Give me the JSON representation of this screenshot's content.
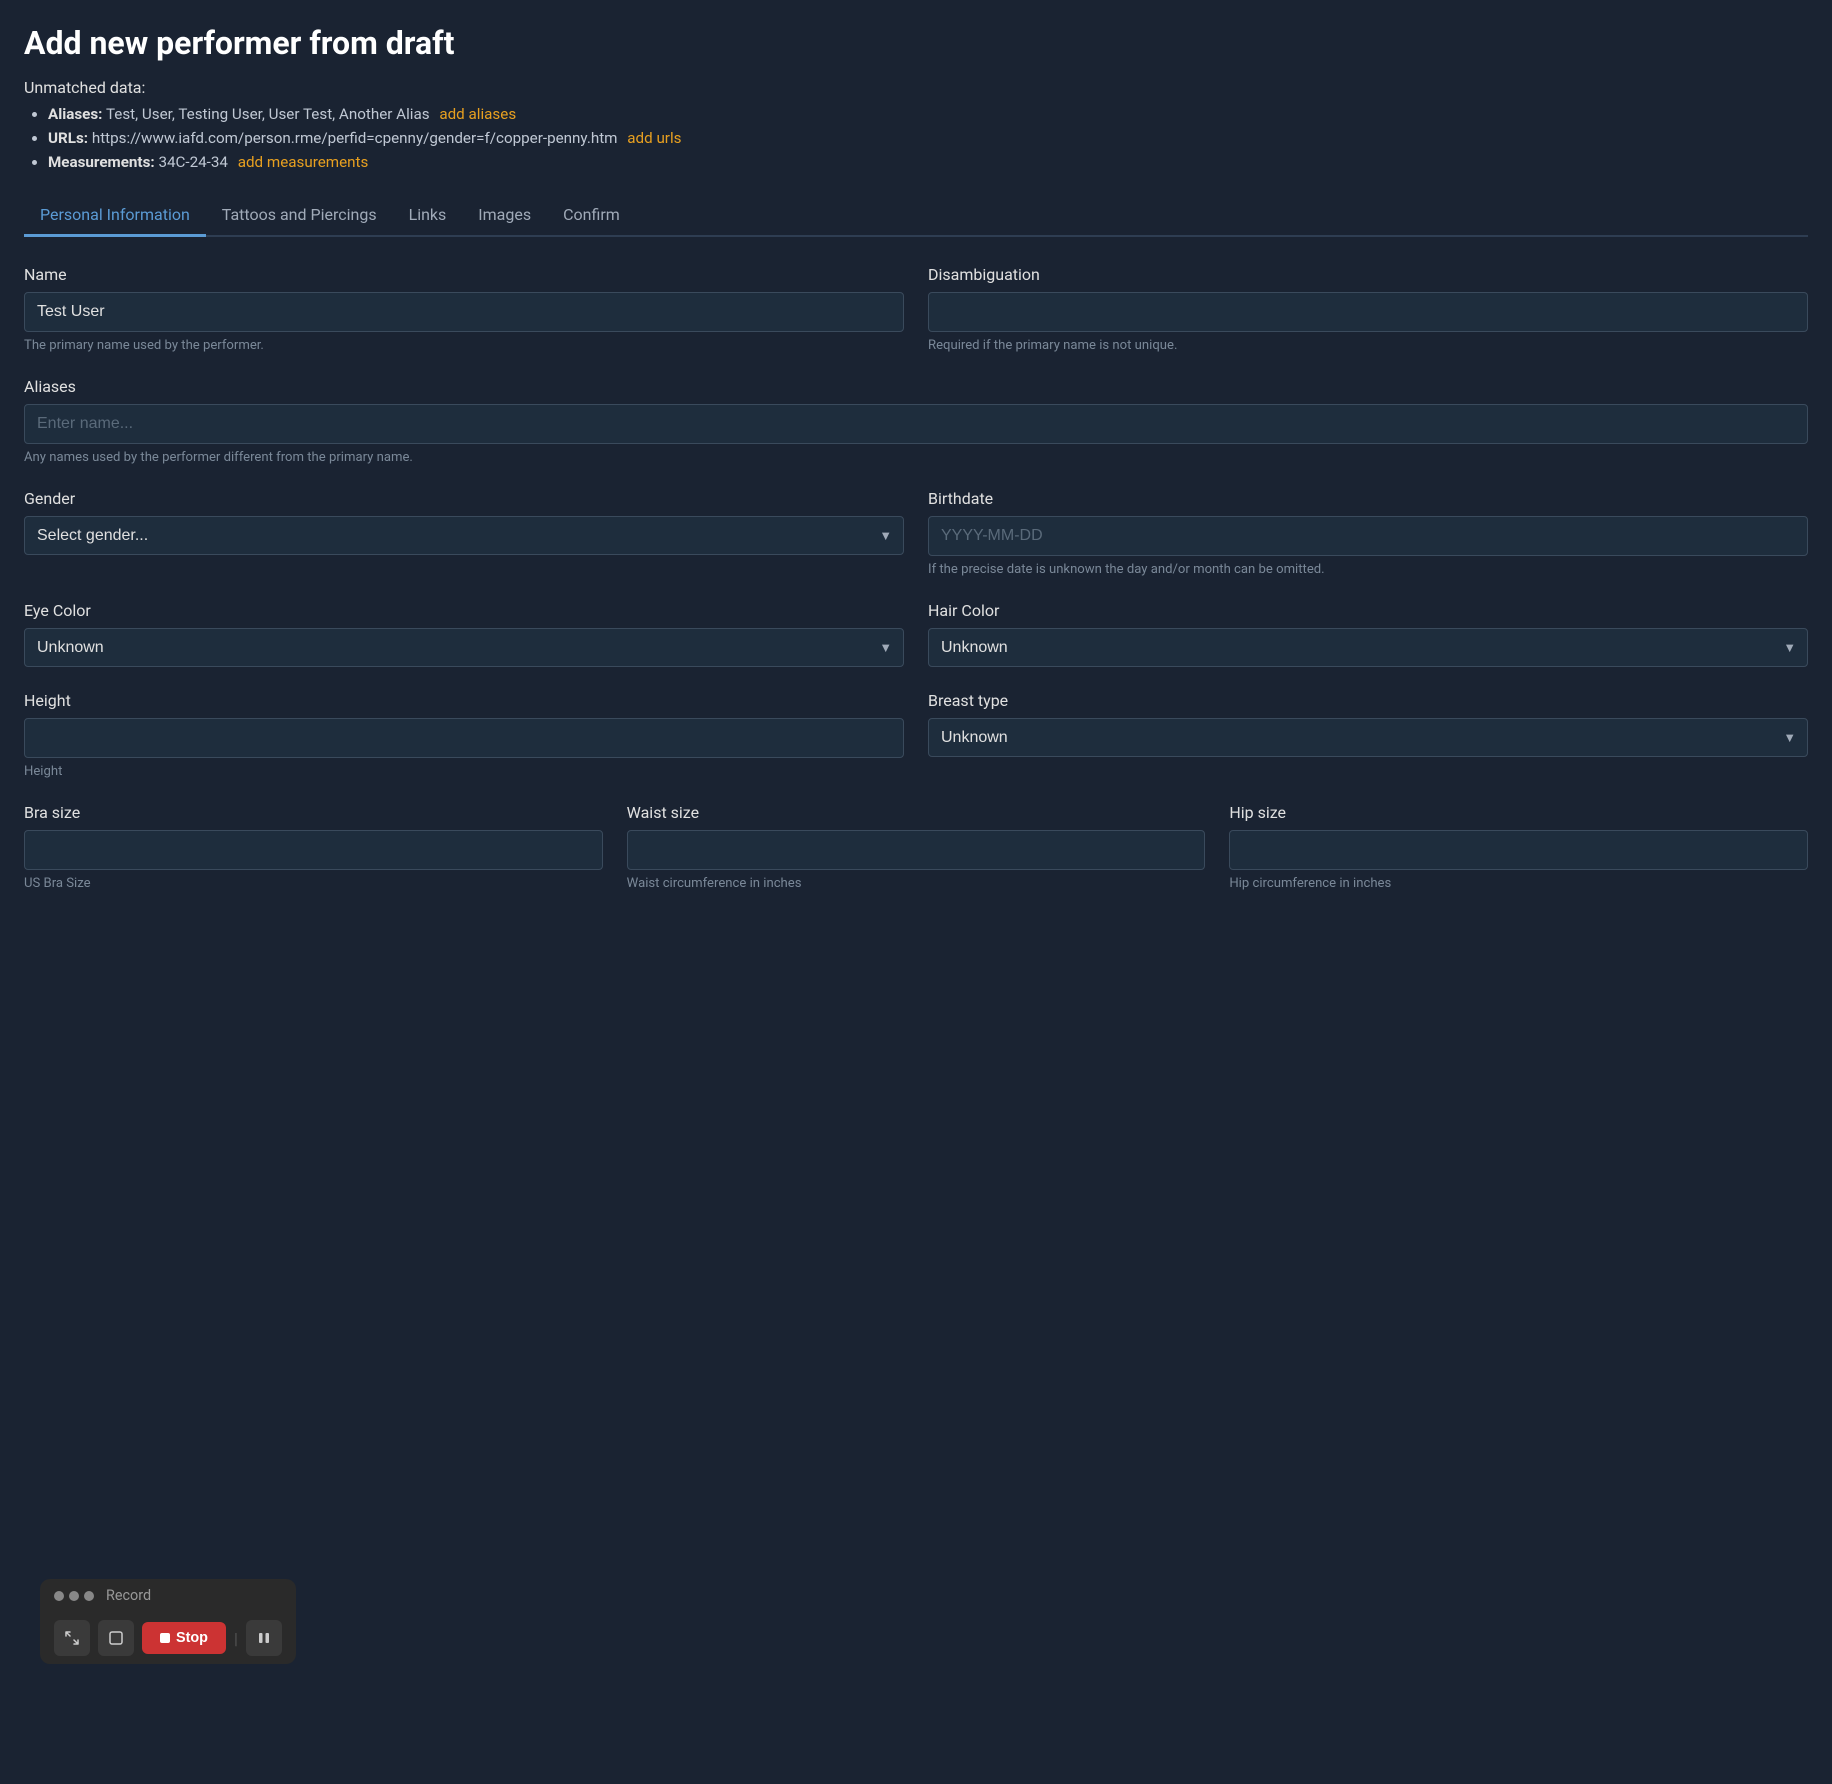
{
  "page": {
    "title": "Add new performer from draft",
    "unmatched": {
      "label": "Unmatched data:",
      "items": [
        {
          "key": "Aliases:",
          "value": "Test, User, Testing User, User Test, Another Alias",
          "action_label": "add aliases"
        },
        {
          "key": "URLs:",
          "value": "https://www.iafd.com/person.rme/perfid=cpenny/gender=f/copper-penny.htm",
          "action_label": "add urls"
        },
        {
          "key": "Measurements:",
          "value": "34C-24-34",
          "action_label": "add measurements"
        }
      ]
    }
  },
  "tabs": [
    {
      "label": "Personal Information",
      "active": true
    },
    {
      "label": "Tattoos and Piercings",
      "active": false
    },
    {
      "label": "Links",
      "active": false
    },
    {
      "label": "Images",
      "active": false
    },
    {
      "label": "Confirm",
      "active": false
    }
  ],
  "form": {
    "name_label": "Name",
    "name_value": "Test User",
    "name_hint": "The primary name used by the performer.",
    "disambiguation_label": "Disambiguation",
    "disambiguation_value": "",
    "disambiguation_placeholder": "",
    "disambiguation_hint": "Required if the primary name is not unique.",
    "aliases_label": "Aliases",
    "aliases_placeholder": "Enter name...",
    "aliases_hint": "Any names used by the performer different from the primary name.",
    "gender_label": "Gender",
    "gender_placeholder": "Select gender...",
    "birthdate_label": "Birthdate",
    "birthdate_placeholder": "YYYY-MM-DD",
    "birthdate_hint": "If the precise date is unknown the day and/or month can be omitted.",
    "eye_color_label": "Eye Color",
    "eye_color_value": "Unknown",
    "hair_color_label": "Hair Color",
    "hair_color_value": "Unknown",
    "height_label": "Height",
    "height_value": "",
    "height_hint": "Height",
    "breast_type_label": "Breast type",
    "breast_type_value": "Unknown",
    "bra_size_label": "Bra size",
    "bra_size_value": "",
    "bra_size_hint": "US Bra Size",
    "waist_size_label": "Waist size",
    "waist_size_value": "",
    "waist_size_hint": "Waist circumference in inches",
    "hip_size_label": "Hip size",
    "hip_size_value": "",
    "hip_size_hint": "Hip circumference in inches"
  },
  "recording": {
    "label": "Record",
    "stop_label": "Stop",
    "dots": [
      "gray",
      "gray",
      "gray"
    ]
  }
}
